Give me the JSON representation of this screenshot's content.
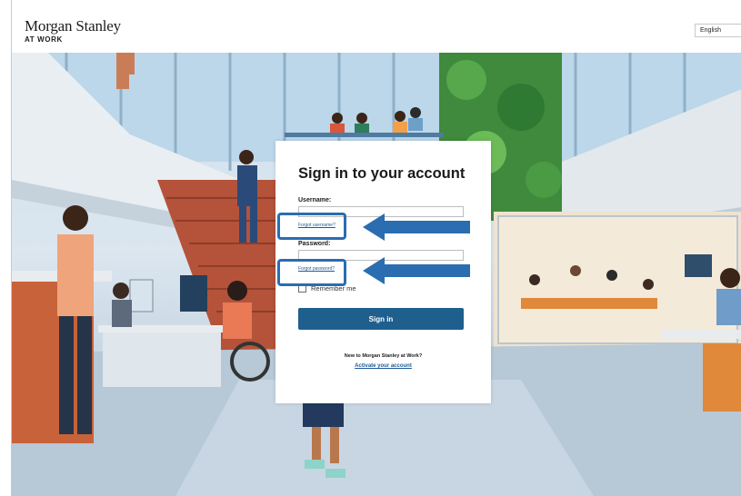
{
  "header": {
    "brand": "Morgan Stanley",
    "brand_sub": "AT WORK",
    "language": "English"
  },
  "signin": {
    "title": "Sign in to your account",
    "username_label": "Username:",
    "forgot_username": "Forgot username?",
    "password_label": "Password:",
    "forgot_password": "Forgot password?",
    "remember_me": "Remember me",
    "signin_button": "Sign in",
    "new_text": "New to Morgan Stanley at Work?",
    "activate_link": "Activate your account"
  },
  "colors": {
    "button": "#1f5f8e",
    "link": "#1f5c99",
    "highlight": "#2a6db0"
  }
}
